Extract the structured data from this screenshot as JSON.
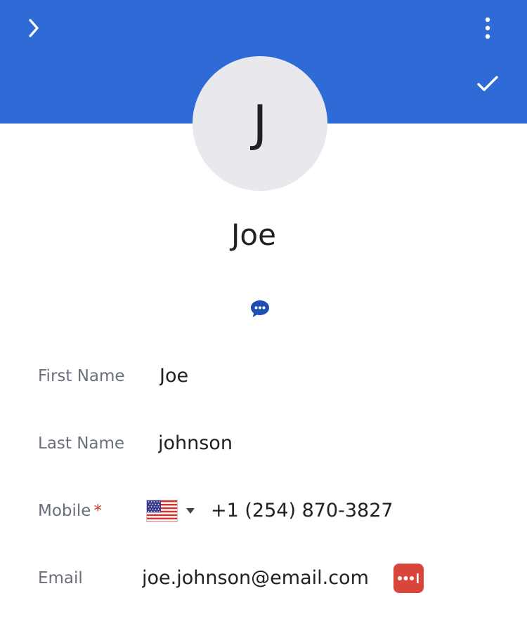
{
  "header": {
    "back_icon": "chevron-right-icon",
    "menu_icon": "more-vertical-icon",
    "save_icon": "check-icon",
    "background": "#2e6bd6"
  },
  "contact": {
    "avatar_initial": "J",
    "name": "Joe",
    "message_icon": "chat-bubble-icon"
  },
  "fields": {
    "first_name": {
      "label": "First Name",
      "value": "Joe"
    },
    "last_name": {
      "label": "Last Name",
      "value": "johnson"
    },
    "mobile": {
      "label": "Mobile",
      "required": "*",
      "country_flag": "us-flag",
      "value": "+1 (254) 870-3827"
    },
    "email": {
      "label": "Email",
      "value": "joe.johnson@email.com",
      "addon_icon": "password-manager-icon"
    }
  },
  "colors": {
    "accent": "#2e6bd6",
    "label": "#6a6f7d",
    "required": "#c0392b",
    "addon": "#d8453b",
    "chat_icon": "#1f4fb5"
  }
}
